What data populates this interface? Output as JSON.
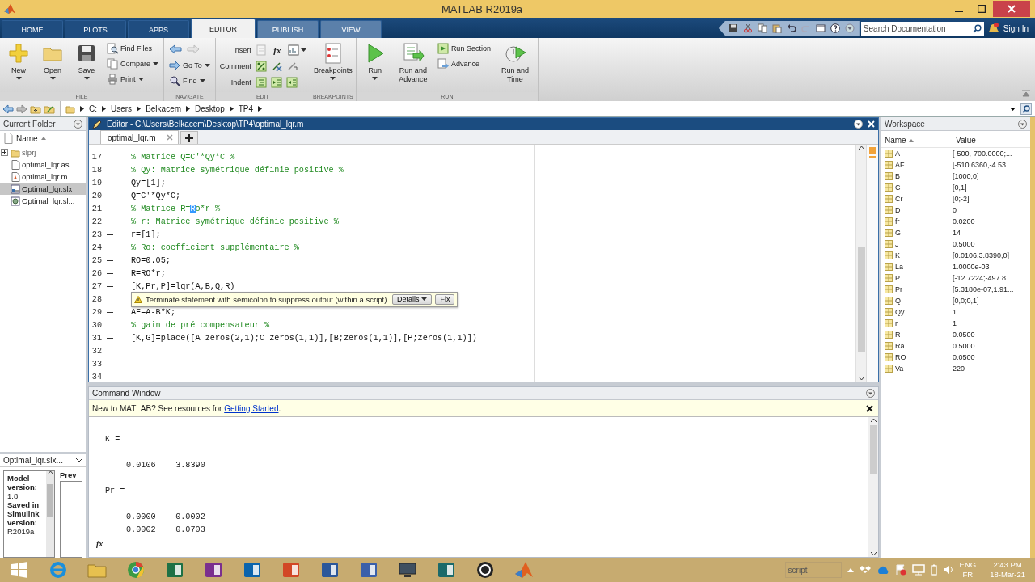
{
  "window": {
    "title": "MATLAB R2019a"
  },
  "tabs": [
    {
      "label": "HOME",
      "selected": false,
      "contextual": false
    },
    {
      "label": "PLOTS",
      "selected": false,
      "contextual": false
    },
    {
      "label": "APPS",
      "selected": false,
      "contextual": false
    },
    {
      "label": "EDITOR",
      "selected": true,
      "contextual": true
    },
    {
      "label": "PUBLISH",
      "selected": false,
      "contextual": true
    },
    {
      "label": "VIEW",
      "selected": false,
      "contextual": true
    }
  ],
  "search": {
    "placeholder": "Search Documentation"
  },
  "sign_in": "Sign In",
  "ribbon": [
    {
      "label": "FILE",
      "items": [
        {
          "kind": "large",
          "label": "New",
          "menu": true
        },
        {
          "kind": "large",
          "label": "Open",
          "menu": true
        },
        {
          "kind": "large",
          "label": "Save",
          "menu": true
        },
        {
          "kind": "stack",
          "buttons": [
            {
              "label": "Find Files",
              "menu": false
            },
            {
              "label": "Compare",
              "menu": true
            },
            {
              "label": "Print",
              "menu": true
            }
          ]
        }
      ]
    },
    {
      "label": "NAVIGATE",
      "items": [
        {
          "kind": "stack",
          "buttons": [
            {
              "kind": "arrows"
            },
            {
              "label": "Go To",
              "menu": true
            },
            {
              "label": "Find",
              "menu": true
            }
          ]
        }
      ]
    },
    {
      "label": "EDIT",
      "items": [
        {
          "kind": "edit_rows",
          "rows": [
            {
              "label": "Insert",
              "symbol": "fx"
            },
            {
              "label": "Comment"
            },
            {
              "label": "Indent"
            }
          ]
        }
      ]
    },
    {
      "label": "BREAKPOINTS",
      "items": [
        {
          "kind": "large",
          "label": "Breakpoints",
          "menu": true
        }
      ]
    },
    {
      "label": "RUN",
      "items": [
        {
          "kind": "large",
          "label": "Run",
          "menu": true
        },
        {
          "kind": "large",
          "label": "Run and Advance",
          "menu": false
        },
        {
          "kind": "stack",
          "buttons": [
            {
              "label": "Run Section",
              "menu": false
            },
            {
              "label": "Advance",
              "menu": false
            }
          ]
        },
        {
          "kind": "large",
          "label": "Run and Time",
          "menu": false
        }
      ]
    }
  ],
  "address": {
    "path": [
      "C:",
      "Users",
      "Belkacem",
      "Desktop",
      "TP4"
    ]
  },
  "current_folder": {
    "title": "Current Folder",
    "column": "Name",
    "items": [
      {
        "name": "slprj",
        "kind": "folder",
        "expanded": false,
        "selected": false
      },
      {
        "name": "optimal_lqr.as",
        "kind": "asv",
        "selected": false
      },
      {
        "name": "optimal_lqr.m",
        "kind": "m",
        "selected": false
      },
      {
        "name": "Optimal_lqr.slx",
        "kind": "slx",
        "selected": true
      },
      {
        "name": "Optimal_lqr.sl...",
        "kind": "slxc",
        "selected": false
      }
    ]
  },
  "details": {
    "title": "Optimal_lqr.slx...",
    "fields": [
      {
        "label": "Model version:",
        "value": "1.8"
      },
      {
        "label": "Saved in Simulink version:",
        "value": "R2019a"
      }
    ],
    "preview_label": "Prev"
  },
  "editor": {
    "title": "Editor - C:\\Users\\Belkacem\\Desktop\\TP4\\optimal_lqr.m",
    "tabs": [
      {
        "label": "optimal_lqr.m",
        "selected": true
      }
    ],
    "lines": [
      {
        "number": "17",
        "executable": false,
        "kind": "comment",
        "segments": [
          {
            "text": "% Matrice Q=C'*Qy*C %",
            "selected": false
          }
        ]
      },
      {
        "number": "18",
        "executable": false,
        "kind": "comment",
        "segments": [
          {
            "text": "% Qy: Matrice symétrique définie positive %",
            "selected": false
          }
        ]
      },
      {
        "number": "19",
        "executable": true,
        "kind": "code",
        "segments": [
          {
            "text": "Qy=[1];",
            "selected": false
          }
        ]
      },
      {
        "number": "20",
        "executable": true,
        "kind": "code",
        "segments": [
          {
            "text": "Q=C'*Qy*C;",
            "selected": false
          }
        ]
      },
      {
        "number": "21",
        "executable": false,
        "kind": "comment",
        "segments": [
          {
            "text": "% Matrice R=",
            "selected": false
          },
          {
            "text": "R",
            "selected": true
          },
          {
            "text": "o*r %",
            "selected": false
          }
        ]
      },
      {
        "number": "22",
        "executable": false,
        "kind": "comment",
        "segments": [
          {
            "text": "% r: Matrice symétrique définie positive %",
            "selected": false
          }
        ]
      },
      {
        "number": "23",
        "executable": true,
        "kind": "code",
        "segments": [
          {
            "text": "r=[1];",
            "selected": false
          }
        ]
      },
      {
        "number": "24",
        "executable": false,
        "kind": "comment",
        "segments": [
          {
            "text": "% Ro: coefficient supplémentaire %",
            "selected": false
          }
        ]
      },
      {
        "number": "25",
        "executable": true,
        "kind": "code",
        "segments": [
          {
            "text": "RO=0.05;",
            "selected": false
          }
        ]
      },
      {
        "number": "26",
        "executable": true,
        "kind": "code",
        "segments": [
          {
            "text": "R=RO*r;",
            "selected": false
          }
        ]
      },
      {
        "number": "27",
        "executable": true,
        "kind": "code",
        "segments": [
          {
            "text": "[K,Pr,P]=lqr(A,B,Q,R)",
            "selected": false
          }
        ]
      },
      {
        "number": "28",
        "executable": false,
        "tooltip": {
          "message": "Terminate statement with semicolon to suppress output (within a script).",
          "buttons": [
            {
              "label": "Details",
              "menu": true
            },
            {
              "label": "Fix",
              "menu": false
            }
          ]
        }
      },
      {
        "number": "29",
        "executable": true,
        "kind": "code",
        "segments": [
          {
            "text": "AF=A-B*K;",
            "selected": false
          }
        ]
      },
      {
        "number": "30",
        "executable": false,
        "kind": "comment",
        "segments": [
          {
            "text": "% gain de pré compensateur %",
            "selected": false
          }
        ]
      },
      {
        "number": "31",
        "executable": true,
        "kind": "code",
        "segments": [
          {
            "text": "[K,G]=place([A zeros(2,1);C zeros(1,1)],[B;zeros(1,1)],[P;zeros(1,1)])",
            "selected": false
          }
        ]
      },
      {
        "number": "32",
        "executable": false
      },
      {
        "number": "33",
        "executable": false
      },
      {
        "number": "34",
        "executable": false
      }
    ]
  },
  "command_window": {
    "title": "Command Window",
    "banner": {
      "before": "New to MATLAB? See resources for",
      "link": "Getting Started",
      "after": "."
    },
    "output": [
      {
        "name": "K =",
        "rows": [
          "0.0106    3.8390"
        ]
      },
      {
        "name": "Pr =",
        "rows": [
          "0.0000    0.0002",
          "0.0002    0.0703"
        ]
      }
    ],
    "prompt": "fx"
  },
  "workspace": {
    "title": "Workspace",
    "columns": [
      "Name",
      "Value"
    ],
    "rows": [
      {
        "name": "A",
        "value": "[-500,-700.0000;..."
      },
      {
        "name": "AF",
        "value": "[-510.6360,-4.53..."
      },
      {
        "name": "B",
        "value": "[1000;0]"
      },
      {
        "name": "C",
        "value": "[0,1]"
      },
      {
        "name": "Cr",
        "value": "[0;-2]"
      },
      {
        "name": "D",
        "value": "0"
      },
      {
        "name": "fr",
        "value": "0.0200"
      },
      {
        "name": "G",
        "value": "14"
      },
      {
        "name": "J",
        "value": "0.5000"
      },
      {
        "name": "K",
        "value": "[0.0106,3.8390,0]"
      },
      {
        "name": "La",
        "value": "1.0000e-03"
      },
      {
        "name": "P",
        "value": "[-12.7224;-497.8..."
      },
      {
        "name": "Pr",
        "value": "[5.3180e-07,1.91..."
      },
      {
        "name": "Q",
        "value": "[0,0;0,1]"
      },
      {
        "name": "Qy",
        "value": "1"
      },
      {
        "name": "r",
        "value": "1"
      },
      {
        "name": "R",
        "value": "0.0500"
      },
      {
        "name": "Ra",
        "value": "0.5000"
      },
      {
        "name": "RO",
        "value": "0.0500"
      },
      {
        "name": "Va",
        "value": "220"
      }
    ]
  },
  "taskbar": {
    "status_text": "script",
    "language": "ENG",
    "layout": "FR",
    "time": "2:43 PM",
    "date": "18-Mar-21"
  }
}
